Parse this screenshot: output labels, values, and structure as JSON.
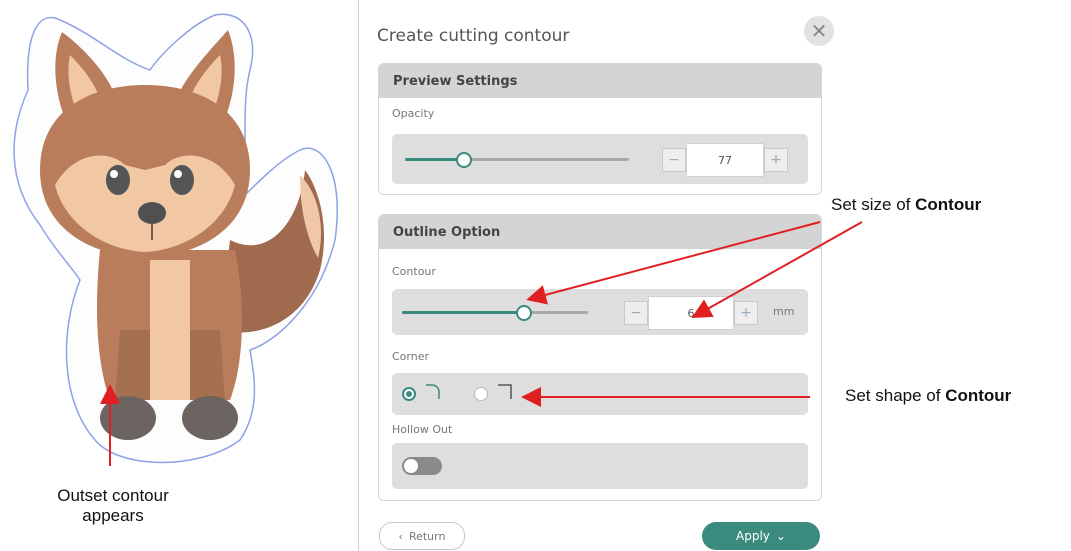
{
  "panel": {
    "title": "Create cutting contour",
    "close_icon": "close-icon"
  },
  "preview": {
    "header": "Preview Settings",
    "opacity_label": "Opacity",
    "opacity_value": "77",
    "opacity_fraction": 0.77,
    "minus": "−",
    "plus": "+"
  },
  "outline": {
    "header": "Outline Option",
    "contour_label": "Contour",
    "contour_value": "6",
    "contour_unit": "mm",
    "minus": "−",
    "plus": "+",
    "corner_label": "Corner",
    "corner_options": [
      "round",
      "square"
    ],
    "corner_selected": "round",
    "hollow_label": "Hollow Out",
    "hollow_enabled": false
  },
  "footer": {
    "return_label": "Return",
    "return_icon": "chevron-left-icon",
    "apply_label": "Apply",
    "apply_icon": "chevron-down-icon"
  },
  "annotations": {
    "size_prefix": "Set size  of ",
    "size_bold": "Contour",
    "shape_prefix": "Set shape of ",
    "shape_bold": "Contour",
    "outset_line1": "Outset contour",
    "outset_line2": "appears"
  },
  "colors": {
    "accent": "#3a8a7e",
    "arrow": "#e02020",
    "outline": "#7f8fe0"
  }
}
